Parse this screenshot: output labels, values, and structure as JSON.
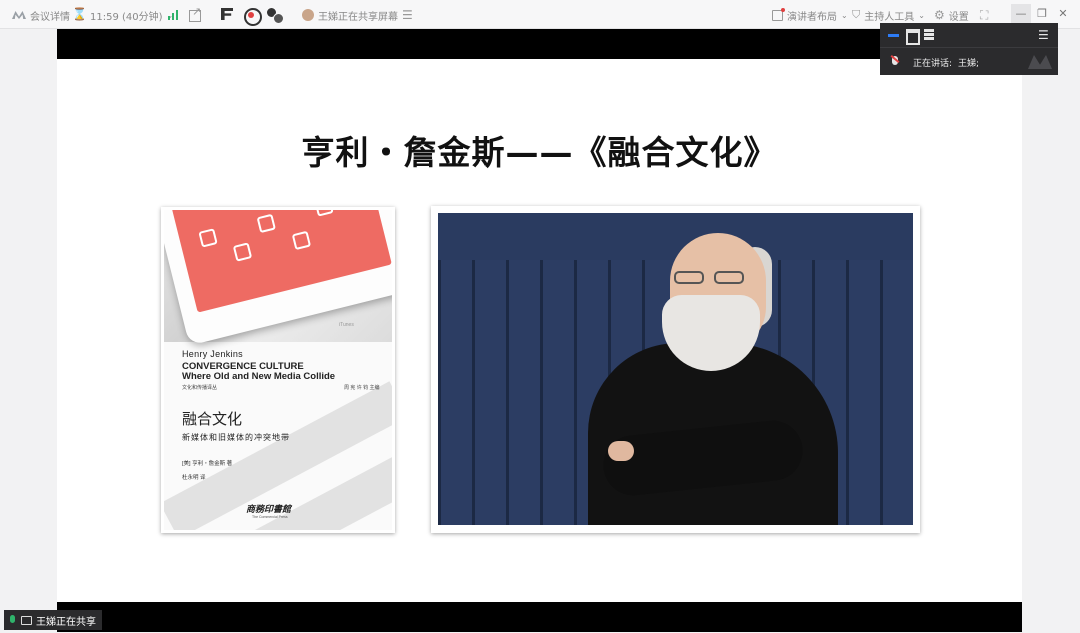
{
  "topbar": {
    "meeting_info": "会议详情",
    "timer": "11:59 (40分钟)",
    "sharing_status": "王娣正在共享屏幕",
    "presenter_layout": "演讲者布局",
    "host_tools": "主持人工具",
    "settings": "设置"
  },
  "speaker_panel": {
    "speaking_label": "正在讲话:",
    "speaker_name": "王娣;"
  },
  "slide": {
    "title": "亨利・詹金斯——《融合文化》",
    "book": {
      "itunes": "iTunes",
      "author_en": "Henry Jenkins",
      "title_en_1": "CONVERGENCE CULTURE",
      "title_en_2": "Where Old and New Media Collide",
      "series": "文化和传播译丛",
      "editors": "周 宪  许 钧  主编",
      "title_cn": "融合文化",
      "subtitle_cn": "新媒体和旧媒体的冲突地带",
      "author_cn": "[美] 亨利・詹金斯 著",
      "translator": "杜永明 译",
      "publisher": "商務印書館",
      "publisher_en": "The Commercial Press"
    }
  },
  "share_tag": {
    "label": "王娣正在共享"
  },
  "colors": {
    "accent_blue": "#2d7cf6",
    "panel_bg": "#2b2b2d",
    "book_red": "#ee6b63",
    "photo_bg": "#233253"
  }
}
